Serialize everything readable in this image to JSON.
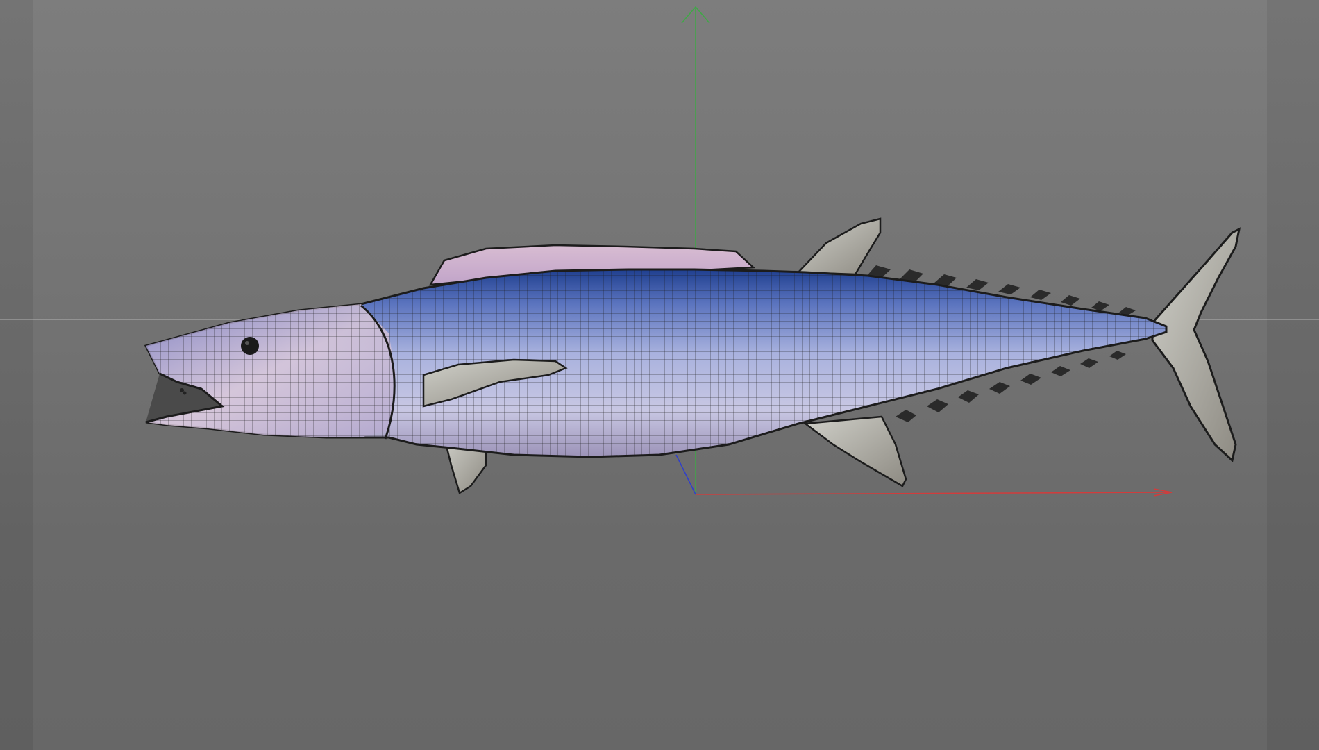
{
  "viewport": {
    "background_top": "#7d7d7d",
    "background_bottom": "#676767"
  },
  "gizmo": {
    "x_axis_color": "#d23c3c",
    "y_axis_color": "#3fa846",
    "z_axis_color": "#2f3fcc"
  },
  "horizon": {
    "color": "#c4c4c4"
  },
  "model": {
    "wireframe_color": "#1c1c1c",
    "body_colors": [
      "#d9c7d9",
      "#a9b2de",
      "#5a73be",
      "#1f3f8f"
    ]
  }
}
